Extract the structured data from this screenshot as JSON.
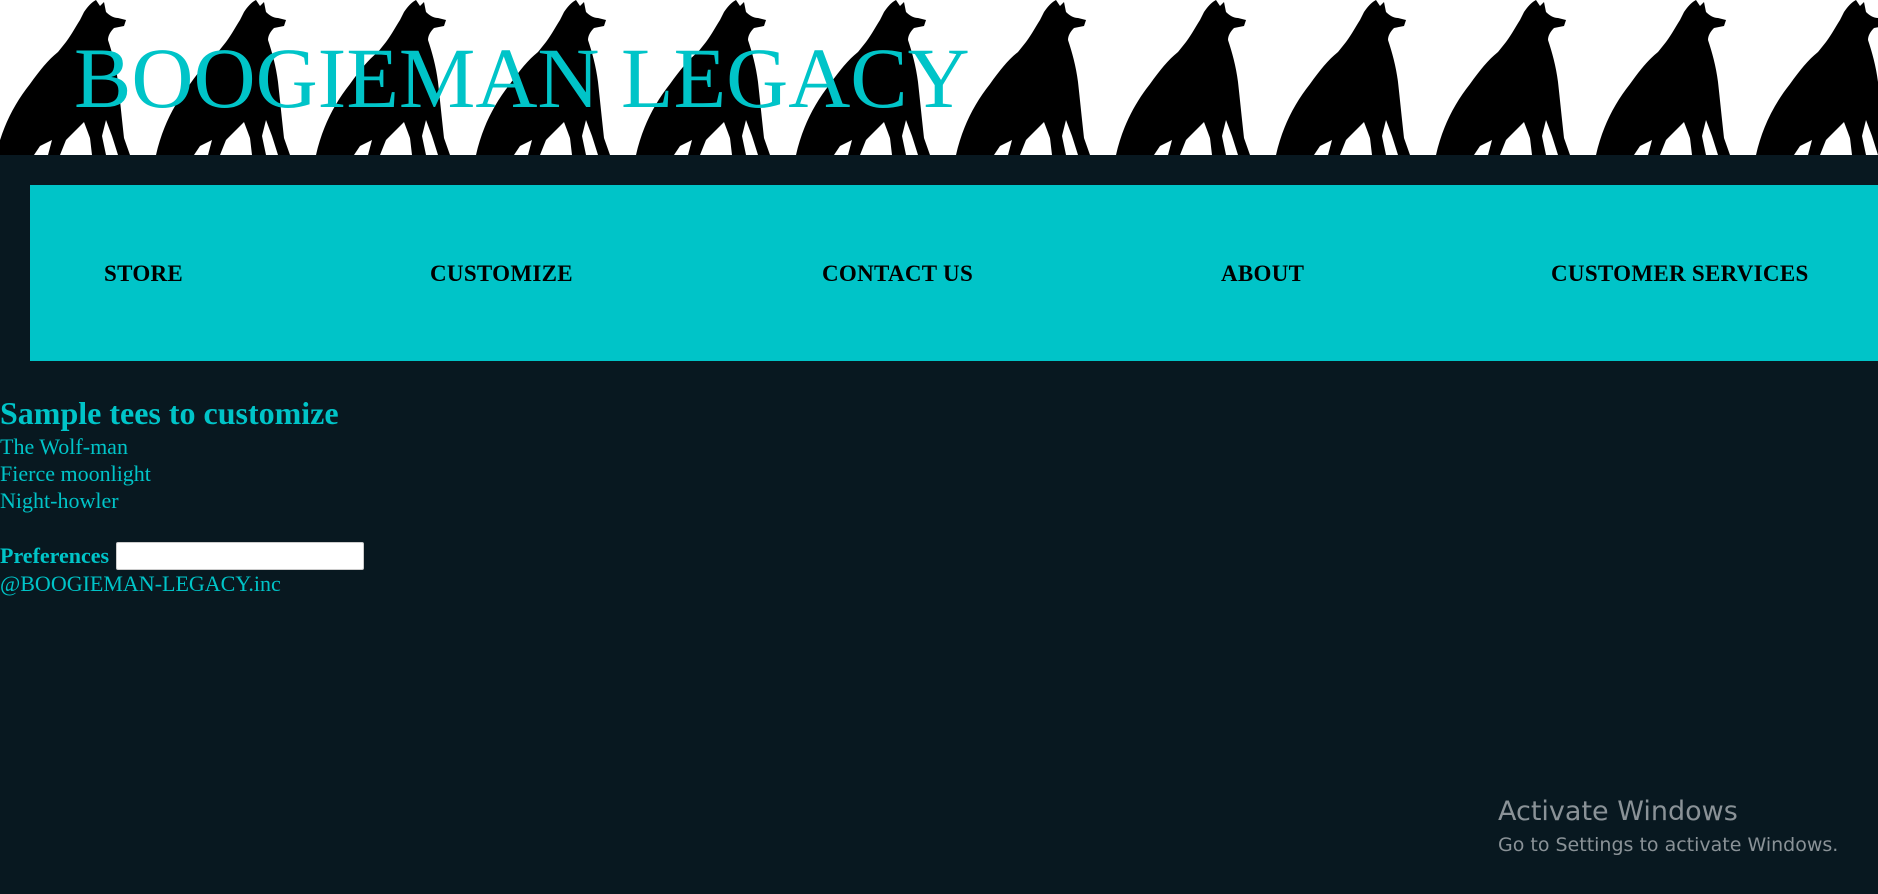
{
  "colors": {
    "accent": "#00c4c8",
    "background": "#081820",
    "nav_text": "#000000",
    "header_bg": "#ffffff",
    "wolf": "#000000"
  },
  "header": {
    "title": "BOOGIEMAN LEGACY",
    "pattern_icon": "howling-wolf-icon"
  },
  "nav": {
    "items": [
      {
        "label": "STORE"
      },
      {
        "label": "CUSTOMIZE"
      },
      {
        "label": "CONTACT US"
      },
      {
        "label": "ABOUT"
      },
      {
        "label": "CUSTOMER SERVICES"
      }
    ]
  },
  "main": {
    "section_title": "Sample tees to customize",
    "tees": [
      {
        "name": "The Wolf-man"
      },
      {
        "name": "Fierce moonlight"
      },
      {
        "name": "Night-howler"
      }
    ],
    "preferences": {
      "label": "Preferences",
      "value": "",
      "placeholder": ""
    },
    "copyright": "@BOOGIEMAN-LEGACY.inc"
  },
  "watermark": {
    "title": "Activate Windows",
    "subtitle": "Go to Settings to activate Windows."
  }
}
